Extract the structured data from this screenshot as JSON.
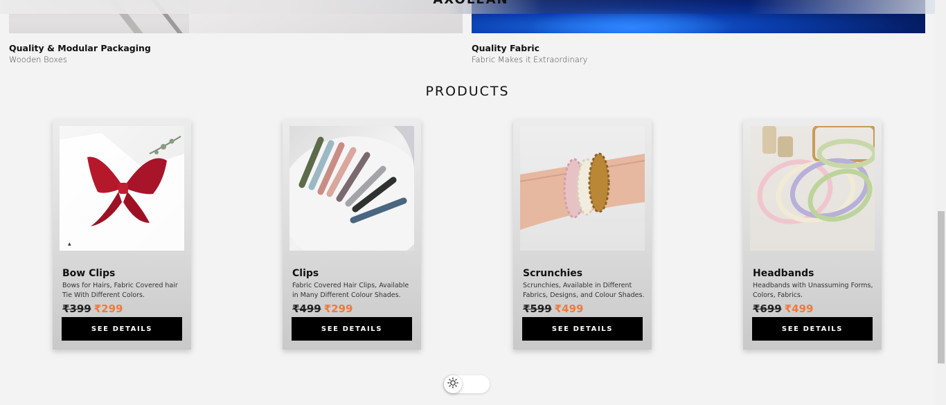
{
  "brand_peek": "AXOLEAN",
  "features": [
    {
      "title": "Quality & Modular Packaging",
      "subtitle": "Wooden Boxes"
    },
    {
      "title": "Quality Fabric",
      "subtitle": "Fabric Makes it Extraordinary"
    }
  ],
  "section_title": "PRODUCTS",
  "products": [
    {
      "name": "Bow Clips",
      "description": "Bows for Hairs, Fabric Covered hair Tie With Different Colors.",
      "old_price": "₹399",
      "new_price": "₹299",
      "button": "SEE DETAILS"
    },
    {
      "name": "Clips",
      "description": "Fabric Covered Hair Clips, Available in Many Different Colour Shades.",
      "old_price": "₹499",
      "new_price": "₹299",
      "button": "SEE DETAILS"
    },
    {
      "name": "Scrunchies",
      "description": "Scrunchies, Available in Different Fabrics, Designs, and Colour Shades.",
      "old_price": "₹599",
      "new_price": "₹499",
      "button": "SEE DETAILS"
    },
    {
      "name": "Headbands",
      "description": "Headbands with Unassuming Forms, Colors, Fabrics.",
      "old_price": "₹699",
      "new_price": "₹499",
      "button": "SEE DETAILS"
    }
  ],
  "theme_toggle": {
    "icon": "sun-icon",
    "state": "light"
  },
  "colors": {
    "accent_price": "#f0793a",
    "button_bg": "#000000",
    "page_bg": "#f3f3f3"
  }
}
